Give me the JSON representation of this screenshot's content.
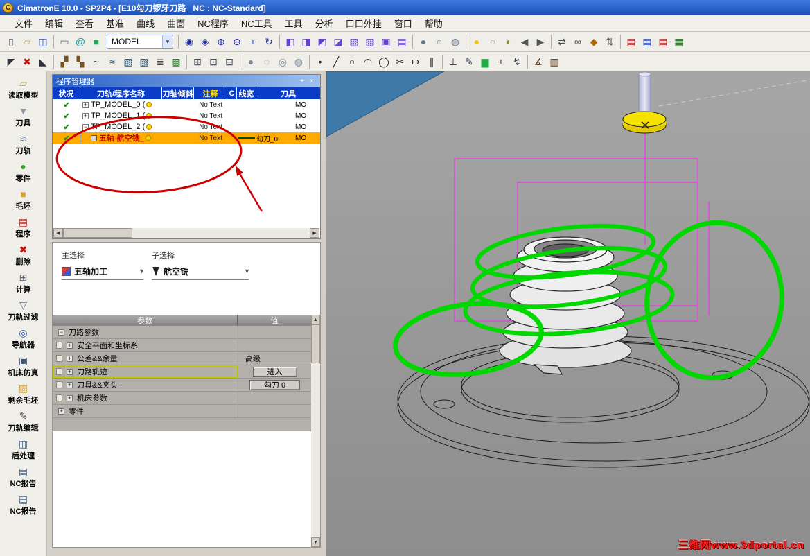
{
  "window": {
    "title": "CimatronE 10.0 - SP2P4 - [E10勾刀锣牙刀路 _NC : NC-Standard]",
    "logo_letter": "C"
  },
  "menu": {
    "items": [
      "文件",
      "编辑",
      "查看",
      "基准",
      "曲线",
      "曲面",
      "NC程序",
      "NC工具",
      "工具",
      "分析",
      "口口外挂",
      "窗口",
      "帮助"
    ]
  },
  "toolbar": {
    "model_combo": "MODEL",
    "row1": [
      {
        "n": "new-file",
        "g": "▯",
        "c": "#555577"
      },
      {
        "n": "open-folder",
        "g": "▱",
        "c": "#cc9922"
      },
      {
        "n": "save",
        "g": "◫",
        "c": "#3355bb"
      },
      {
        "t": "sep"
      },
      {
        "n": "print",
        "g": "▭",
        "c": "#556677"
      },
      {
        "n": "browser",
        "g": "@",
        "c": "#119999"
      },
      {
        "n": "model-tree",
        "g": "■",
        "c": "#22aa55"
      },
      {
        "t": "combo",
        "n": "model-combo"
      },
      {
        "t": "sep"
      },
      {
        "n": "zoom-all",
        "g": "◉",
        "c": "#26309a"
      },
      {
        "n": "zoom-window",
        "g": "◈",
        "c": "#26309a"
      },
      {
        "n": "zoom-in",
        "g": "⊕",
        "c": "#26309a"
      },
      {
        "n": "zoom-out",
        "g": "⊖",
        "c": "#26309a"
      },
      {
        "n": "pan",
        "g": "+",
        "c": "#26309a"
      },
      {
        "n": "rotate-view",
        "g": "↻",
        "c": "#26309a"
      },
      {
        "t": "sep"
      },
      {
        "n": "view-isometric",
        "g": "◧",
        "c": "#6644cc"
      },
      {
        "n": "view-front",
        "g": "◨",
        "c": "#6644cc"
      },
      {
        "n": "view-top",
        "g": "◩",
        "c": "#6644cc"
      },
      {
        "n": "view-bottom",
        "g": "◪",
        "c": "#6644cc"
      },
      {
        "n": "view-left",
        "g": "▧",
        "c": "#6644cc"
      },
      {
        "n": "view-right",
        "g": "▨",
        "c": "#6644cc"
      },
      {
        "n": "view-back",
        "g": "▣",
        "c": "#6644cc"
      },
      {
        "n": "view-custom",
        "g": "▤",
        "c": "#6644cc"
      },
      {
        "t": "sep"
      },
      {
        "n": "shaded-mode",
        "g": "●",
        "c": "#667788"
      },
      {
        "n": "wireframe-mode",
        "g": "○",
        "c": "#667788"
      },
      {
        "n": "hidden-line-mode",
        "g": "◍",
        "c": "#667788"
      },
      {
        "t": "sep"
      },
      {
        "n": "lamp-on",
        "g": "●",
        "c": "#eec400"
      },
      {
        "n": "lamp-off",
        "g": "○",
        "c": "#999999"
      },
      {
        "n": "spotlight",
        "g": "◐",
        "c": "#888800"
      },
      {
        "n": "prev-step",
        "g": "◀",
        "c": "#555555"
      },
      {
        "n": "next-step",
        "g": "▶",
        "c": "#555555"
      },
      {
        "t": "sep"
      },
      {
        "n": "swap-view",
        "g": "⇄",
        "c": "#555555"
      },
      {
        "n": "link-entities",
        "g": "∞",
        "c": "#555555"
      },
      {
        "n": "tag-entity",
        "g": "◆",
        "c": "#b06a00"
      },
      {
        "n": "exchange-data",
        "g": "⇅",
        "c": "#555555"
      },
      {
        "t": "sep"
      },
      {
        "n": "nc-doc-red",
        "g": "▤",
        "c": "#aa2222"
      },
      {
        "n": "nc-doc-blue",
        "g": "▤",
        "c": "#2244aa"
      },
      {
        "n": "nc-report-doc",
        "g": "▤",
        "c": "#aa2222"
      },
      {
        "n": "grid-display",
        "g": "▦",
        "c": "#226622"
      }
    ],
    "row2": [
      {
        "n": "select-arrow",
        "g": "◤",
        "c": "#333344"
      },
      {
        "n": "delete-entity",
        "g": "✖",
        "c": "#bb1111"
      },
      {
        "n": "pick-filter",
        "g": "◣",
        "c": "#333344"
      },
      {
        "t": "sep"
      },
      {
        "n": "feature-a",
        "g": "▞",
        "c": "#775522"
      },
      {
        "n": "feature-b",
        "g": "▚",
        "c": "#775522"
      },
      {
        "n": "curve-a",
        "g": "~",
        "c": "#225577"
      },
      {
        "n": "curve-b",
        "g": "≈",
        "c": "#225577"
      },
      {
        "n": "surface-a",
        "g": "▧",
        "c": "#225577"
      },
      {
        "n": "surface-b",
        "g": "▨",
        "c": "#225577"
      },
      {
        "n": "level-filter",
        "g": "≣",
        "c": "#444444"
      },
      {
        "n": "color-filter",
        "g": "▩",
        "c": "#338833"
      },
      {
        "t": "sep"
      },
      {
        "n": "snap-grid",
        "g": "⊞",
        "c": "#444466"
      },
      {
        "n": "snap-end",
        "g": "⊡",
        "c": "#444466"
      },
      {
        "n": "snap-mid",
        "g": "⊟",
        "c": "#444466"
      },
      {
        "t": "sep"
      },
      {
        "n": "shaded-display",
        "g": "●",
        "c": "#778899"
      },
      {
        "n": "wireframe-display",
        "g": "◌",
        "c": "#778899"
      },
      {
        "n": "edges-display",
        "g": "◎",
        "c": "#778899"
      },
      {
        "n": "transparency-display",
        "g": "◍",
        "c": "#778899"
      },
      {
        "t": "sep"
      },
      {
        "n": "point-tool",
        "g": "•",
        "c": "#222222"
      },
      {
        "n": "line-tool",
        "g": "╱",
        "c": "#222222"
      },
      {
        "n": "circle-tool",
        "g": "○",
        "c": "#222222"
      },
      {
        "n": "arc-tool",
        "g": "◠",
        "c": "#222222"
      },
      {
        "n": "ellipse-tool",
        "g": "◯",
        "c": "#222222"
      },
      {
        "n": "trim-tool",
        "g": "✂",
        "c": "#222222"
      },
      {
        "n": "extend-tool",
        "g": "↦",
        "c": "#222222"
      },
      {
        "n": "offset-tool",
        "g": "∥",
        "c": "#222222"
      },
      {
        "t": "sep"
      },
      {
        "n": "normal-tool",
        "g": "⊥",
        "c": "#333355"
      },
      {
        "n": "sketch-tool",
        "g": "✎",
        "c": "#333355"
      },
      {
        "n": "color-swatch",
        "g": "▆",
        "c": "#22aa44"
      },
      {
        "n": "ucs-tool",
        "g": "+",
        "c": "#333355"
      },
      {
        "n": "axis-tool",
        "g": "↯",
        "c": "#333355"
      },
      {
        "t": "sep"
      },
      {
        "n": "analyze-angle",
        "g": "∡",
        "c": "#553311"
      },
      {
        "n": "report-list",
        "g": "▥",
        "c": "#553311"
      }
    ]
  },
  "sidebar": {
    "items": [
      {
        "label": "读取模型",
        "icon": "read-model",
        "glyph": "▱",
        "color": "#d7a13a"
      },
      {
        "label": "刀具",
        "icon": "cutter",
        "glyph": "▼",
        "color": "#8899aa"
      },
      {
        "label": "刀轨",
        "icon": "toolpath",
        "glyph": "≋",
        "color": "#667788"
      },
      {
        "label": "零件",
        "icon": "part",
        "glyph": "●",
        "color": "#2ca02c"
      },
      {
        "label": "毛坯",
        "icon": "stock",
        "glyph": "■",
        "color": "#d7a13a"
      },
      {
        "label": "程序",
        "icon": "program",
        "glyph": "▤",
        "color": "#aa3333"
      },
      {
        "label": "删除",
        "icon": "delete",
        "glyph": "✖",
        "color": "#cc1111"
      },
      {
        "label": "计算",
        "icon": "calculate",
        "glyph": "⊞",
        "color": "#666677"
      },
      {
        "label": "刀轨过滤",
        "icon": "toolpath-filter",
        "glyph": "▽",
        "color": "#667788"
      },
      {
        "label": "导航器",
        "icon": "navigator",
        "glyph": "◎",
        "color": "#2255cc"
      },
      {
        "label": "机床仿真",
        "icon": "machine-sim",
        "glyph": "▣",
        "color": "#445566"
      },
      {
        "label": "剩余毛坯",
        "icon": "remaining-stock",
        "glyph": "▨",
        "color": "#d7a13a"
      },
      {
        "label": "刀轨编辑",
        "icon": "toolpath-edit",
        "glyph": "✎",
        "color": "#333344"
      },
      {
        "label": "后处理",
        "icon": "post-process",
        "glyph": "▥",
        "color": "#556677"
      },
      {
        "label": "NC报告",
        "icon": "nc-report-1",
        "glyph": "▤",
        "color": "#556677"
      },
      {
        "label": "NC报告",
        "icon": "nc-report-2",
        "glyph": "▤",
        "color": "#556677"
      }
    ]
  },
  "program_manager": {
    "title": "程序管理器",
    "columns": [
      "状况",
      "刀轨/程序名称",
      "刀轴倾斜",
      "注释",
      "C",
      "线宽",
      "刀具"
    ],
    "rows": [
      {
        "expand": "plus",
        "name": "TP_MODEL_0 (",
        "note": "No Text",
        "extra": "MO"
      },
      {
        "expand": "plus",
        "name": "TP_MODEL_1 (",
        "note": "No Text",
        "extra": "MO"
      },
      {
        "expand": "minus",
        "name": "TP_MODEL_2 (",
        "note": "No Text",
        "extra": "MO"
      },
      {
        "child": true,
        "selected": true,
        "name": "五轴-航空铣_",
        "note": "No Text",
        "line": true,
        "tool": "勾刀_0",
        "extra": "MO"
      }
    ]
  },
  "selection": {
    "primary_label": "主选择",
    "primary_value": "五轴加工",
    "secondary_label": "子选择",
    "secondary_value": "航空铣"
  },
  "parameters": {
    "header_param": "参数",
    "header_value": "值",
    "rows": [
      {
        "expand": "minus",
        "icon": false,
        "label": "刀路参数",
        "value": "",
        "button": false
      },
      {
        "expand": "plus",
        "icon": true,
        "label": "安全平面和坐标系",
        "value": "",
        "button": false
      },
      {
        "expand": "plus",
        "icon": true,
        "label": "公差&&余量",
        "value": "高级",
        "button": false
      },
      {
        "expand": "plus",
        "icon": true,
        "label": "刀路轨迹",
        "value": "进入",
        "button": true,
        "highlight": true
      },
      {
        "expand": "plus",
        "icon": true,
        "label": "刀具&&夹头",
        "value": "勾刀 0",
        "button": true
      },
      {
        "expand": "plus",
        "icon": true,
        "label": "机床参数",
        "value": "",
        "button": false
      },
      {
        "expand": "plus",
        "icon": false,
        "label": "零件",
        "value": "",
        "button": false
      }
    ]
  },
  "viewport": {
    "watermark": "三维网www.3dportal.cn"
  }
}
